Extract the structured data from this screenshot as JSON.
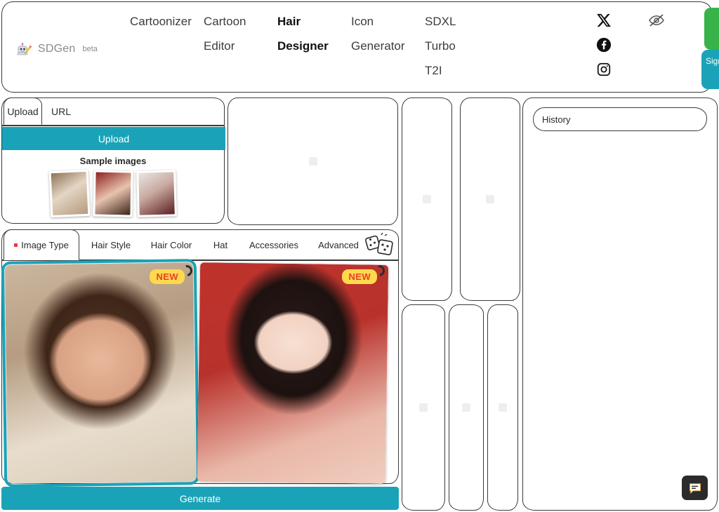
{
  "header": {
    "logo_icon": "robot-pencil-icon",
    "logo_text": "SDGen",
    "logo_beta": "beta",
    "nav": [
      {
        "line1": "Cartoonizer",
        "line2": "",
        "line3": "",
        "active": false
      },
      {
        "line1": "Cartoon",
        "line2": "Editor",
        "line3": "",
        "active": false
      },
      {
        "line1": "Hair",
        "line2": "Designer",
        "line3": "",
        "active": true
      },
      {
        "line1": "Icon",
        "line2": "Generator",
        "line3": "",
        "active": false
      },
      {
        "line1": "SDXL",
        "line2": "Turbo",
        "line3": "T2I",
        "active": false
      }
    ],
    "social": [
      {
        "name": "x-twitter-icon"
      },
      {
        "name": "facebook-icon"
      },
      {
        "name": "instagram-icon"
      }
    ],
    "eye_off_icon": "eye-off-icon",
    "signup_label": "Sign up",
    "green_button_label": ""
  },
  "upload": {
    "tabs": [
      {
        "label": "Upload",
        "active": true
      },
      {
        "label": "URL",
        "active": false
      }
    ],
    "upload_button": "Upload",
    "sample_label": "Sample images",
    "samples": [
      {
        "name": "sample-thumb-1",
        "art": "art-s1"
      },
      {
        "name": "sample-thumb-2",
        "art": "art-s2"
      },
      {
        "name": "sample-thumb-3",
        "art": "art-s3"
      }
    ]
  },
  "preview": {
    "placeholder": ""
  },
  "options": {
    "tabs": [
      {
        "label": "Image Type",
        "active": true,
        "dot": true
      },
      {
        "label": "Hair Style",
        "active": false,
        "dot": false
      },
      {
        "label": "Hair Color",
        "active": false,
        "dot": false
      },
      {
        "label": "Hat",
        "active": false,
        "dot": false
      },
      {
        "label": "Accessories",
        "active": false,
        "dot": false
      },
      {
        "label": "Advanced",
        "active": false,
        "dot": false
      }
    ],
    "dice_icon": "dice-icon",
    "cards": [
      {
        "name": "image-type-card-real",
        "badge": "NEW",
        "selected": true,
        "art": "art-real"
      },
      {
        "name": "image-type-card-anime",
        "badge": "NEW",
        "selected": false,
        "art": "art-anime"
      }
    ]
  },
  "generate_label": "Generate",
  "right": {
    "history_label": "History",
    "panels": [
      {
        "name": "result-panel-1"
      },
      {
        "name": "result-panel-2"
      },
      {
        "name": "result-panel-3"
      },
      {
        "name": "result-panel-4"
      },
      {
        "name": "result-panel-5"
      }
    ]
  },
  "chat_fab_icon": "chat-bubble-icon",
  "colors": {
    "teal": "#1aa3b8",
    "green": "#37b34a",
    "badge_bg": "#ffd84d",
    "badge_text": "#e8402a",
    "outline": "#3a3a3a"
  }
}
